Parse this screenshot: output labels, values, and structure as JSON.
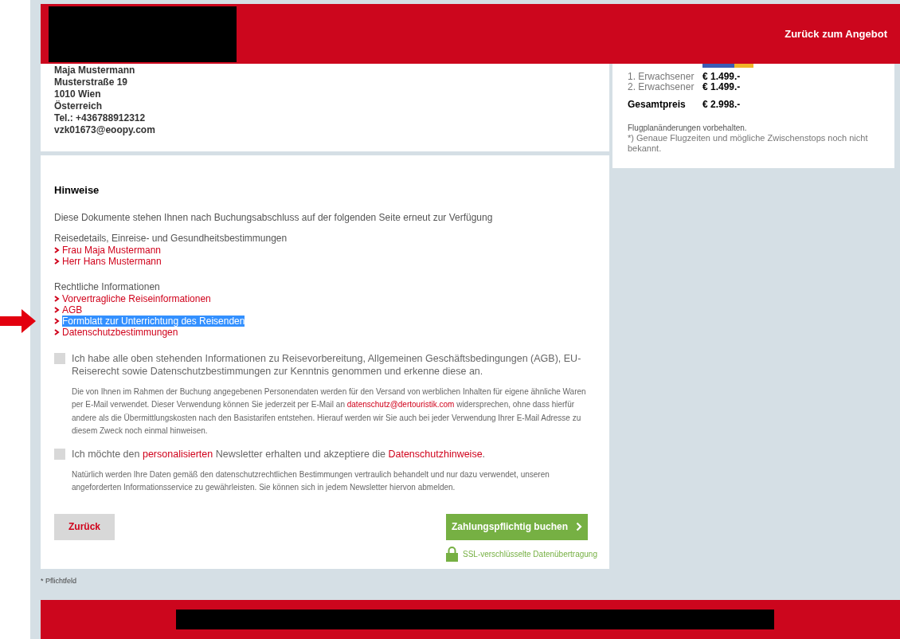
{
  "header": {
    "back_link": "Zurück zum Angebot"
  },
  "address": [
    "Maja Mustermann",
    "Musterstraße 19",
    "1010 Wien",
    "Österreich",
    "Tel.: +436788912312",
    "vzk01673@eoopy.com"
  ],
  "summary": {
    "prices": [
      {
        "label": "1. Erwachsener",
        "value": "€ 1.499.-"
      },
      {
        "label": "2. Erwachsener",
        "value": "€ 1.499.-"
      }
    ],
    "total_label": "Gesamtpreis",
    "total_value": "€ 2.998.-",
    "notes": [
      "Flugplanänderungen vorbehalten.",
      "*) Genaue Flugzeiten und mögliche Zwischenstops noch nicht bekannt."
    ]
  },
  "hinweise": {
    "title": "Hinweise",
    "intro": "Diese Dokumente stehen Ihnen nach Buchungsabschluss auf der folgenden Seite erneut zur Verfügung",
    "groups": [
      {
        "heading": "Reisedetails, Einreise- und Gesundheitsbestimmungen",
        "links": [
          {
            "label": "Frau Maja Mustermann",
            "selected": false
          },
          {
            "label": "Herr Hans Mustermann",
            "selected": false
          }
        ]
      },
      {
        "heading": "Rechtliche Informationen",
        "links": [
          {
            "label": "Vorvertragliche Reiseinformationen",
            "selected": false
          },
          {
            "label": "AGB",
            "selected": false
          },
          {
            "label": "Formblatt zur Unterrichtung des Reisenden",
            "selected": true
          },
          {
            "label": "Datenschutzbestimmungen",
            "selected": false
          }
        ]
      }
    ]
  },
  "consents": [
    {
      "checked": false,
      "label_parts": [
        {
          "text": "Ich habe alle oben stehenden Informationen zu Reisevorbereitung, Allgemeinen Geschäftsbedingungen (AGB), EU-Reiserecht sowie Datenschutzbestimmungen zur Kenntnis genommen und erkenne diese an.",
          "kind": "text"
        }
      ],
      "note_parts": [
        {
          "text": "Die von Ihnen im Rahmen der Buchung angegebenen Personendaten werden für den Versand von werblichen Inhalten für eigene ähnliche Waren per E-Mail verwendet. Dieser Verwendung können Sie jederzeit per E-Mail an ",
          "kind": "text"
        },
        {
          "text": "datenschutz@dertouristik.com",
          "kind": "link"
        },
        {
          "text": " widersprechen, ohne dass hierfür andere als die Übermittlungskosten nach den Basistarifen entstehen. Hierauf werden wir Sie auch bei jeder Verwendung Ihrer E-Mail Adresse zu diesem Zweck noch einmal hinweisen.",
          "kind": "text"
        }
      ]
    },
    {
      "checked": false,
      "label_parts": [
        {
          "text": "Ich möchte den ",
          "kind": "text"
        },
        {
          "text": "personalisierten",
          "kind": "link"
        },
        {
          "text": " Newsletter erhalten und akzeptiere die ",
          "kind": "text"
        },
        {
          "text": "Datenschutzhinweise",
          "kind": "link"
        },
        {
          "text": ".",
          "kind": "text"
        }
      ],
      "note_parts": [
        {
          "text": "Natürlich werden Ihre Daten gemäß den datenschutzrechtlichen Bestimmungen vertraulich behandelt und nur dazu verwendet, unseren angeforderten Informationsservice zu gewährleisten. Sie können sich in jedem Newsletter hiervon abmelden.",
          "kind": "text"
        }
      ]
    }
  ],
  "actions": {
    "back": "Zurück",
    "book": "Zahlungspflichtig buchen",
    "ssl": "SSL-verschlüsselte Datenübertragung"
  },
  "footnote": "* Pflichtfeld"
}
